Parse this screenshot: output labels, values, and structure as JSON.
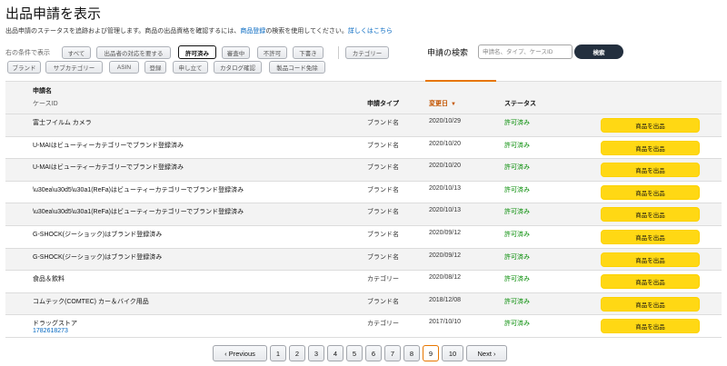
{
  "page": {
    "title": "出品申請を表示",
    "description": "出品申請のステータスを追跡および管理します。商品の出品資格を確認するには、",
    "description_link": "商品登録",
    "description_tail": "の検索を使用してください。",
    "learn_more": "詳しくはこちら"
  },
  "filters": {
    "label": "右の条件で表示",
    "chips": [
      {
        "label": "すべて",
        "active": false
      },
      {
        "label": "出品者の対応を要する",
        "active": false
      },
      {
        "label": "許可済み",
        "active": true
      },
      {
        "label": "審査中",
        "active": false
      },
      {
        "label": "不許可",
        "active": false
      },
      {
        "label": "下書き",
        "active": false
      },
      {
        "label": "カテゴリー",
        "active": false
      },
      {
        "label": "ブランド",
        "active": false
      },
      {
        "label": "サブカテゴリー",
        "active": false
      },
      {
        "label": "ASIN",
        "active": false
      },
      {
        "label": "登録",
        "active": false
      },
      {
        "label": "申し立て",
        "active": false
      },
      {
        "label": "カタログ確認",
        "active": false
      },
      {
        "label": "製品コード免除",
        "active": false
      }
    ]
  },
  "search": {
    "label": "申請の検索",
    "placeholder": "申請名、タイプ、ケースID",
    "button": "検索"
  },
  "table": {
    "headers": {
      "name": "申請名",
      "case_id": "ケースID",
      "type": "申請タイプ",
      "date": "変更日",
      "status": "ステータス"
    },
    "rows": [
      {
        "name": "富士フイルム カメラ",
        "asin": "",
        "type": "ブランド名",
        "date": "2020/10/29",
        "status": "許可済み",
        "action": "商品を出品"
      },
      {
        "name": "U-MAIはビューティーカテゴリーでブランド登録済み",
        "asin": "",
        "type": "ブランド名",
        "date": "2020/10/20",
        "status": "許可済み",
        "action": "商品を出品"
      },
      {
        "name": "U-MAIはビューティーカテゴリーでブランド登録済み",
        "asin": "",
        "type": "ブランド名",
        "date": "2020/10/20",
        "status": "許可済み",
        "action": "商品を出品"
      },
      {
        "name": "\\u30ea\\u30d5\\u30a1(ReFa)はビューティーカテゴリーでブランド登録済み",
        "asin": "",
        "type": "ブランド名",
        "date": "2020/10/13",
        "status": "許可済み",
        "action": "商品を出品"
      },
      {
        "name": "\\u30ea\\u30d5\\u30a1(ReFa)はビューティーカテゴリーでブランド登録済み",
        "asin": "",
        "type": "ブランド名",
        "date": "2020/10/13",
        "status": "許可済み",
        "action": "商品を出品"
      },
      {
        "name": "G-SHOCK(ジーショック)はブランド登録済み",
        "asin": "",
        "type": "ブランド名",
        "date": "2020/09/12",
        "status": "許可済み",
        "action": "商品を出品"
      },
      {
        "name": "G-SHOCK(ジーショック)はブランド登録済み",
        "asin": "",
        "type": "ブランド名",
        "date": "2020/09/12",
        "status": "許可済み",
        "action": "商品を出品"
      },
      {
        "name": "食品＆飲料",
        "asin": "",
        "type": "カテゴリー",
        "date": "2020/08/12",
        "status": "許可済み",
        "action": "商品を出品"
      },
      {
        "name": "コムテック(COMTEC) カー＆バイク用品",
        "asin": "",
        "type": "ブランド名",
        "date": "2018/12/08",
        "status": "許可済み",
        "action": "商品を出品"
      },
      {
        "name": "ドラッグストア",
        "asin": "1782618273",
        "type": "カテゴリー",
        "date": "2017/10/10",
        "status": "許可済み",
        "action": "商品を出品"
      }
    ]
  },
  "pagination": {
    "prev": "‹ Previous",
    "next": "Next ›",
    "pages": [
      "1",
      "2",
      "3",
      "4",
      "5",
      "6",
      "7",
      "8",
      "9",
      "10"
    ],
    "current": "9"
  },
  "colors": {
    "accent": "#e77600",
    "status_ok": "#008a00",
    "action_button": "#ffd814",
    "link": "#0066c0"
  }
}
